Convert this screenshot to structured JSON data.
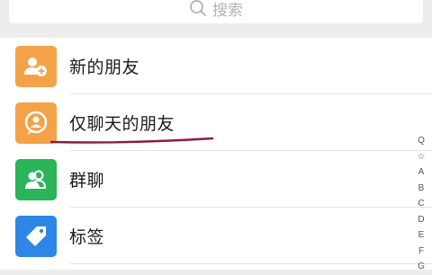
{
  "search": {
    "placeholder": "搜索"
  },
  "contacts_menu": {
    "items": [
      {
        "label": "新的朋友",
        "icon": "add-friend-icon",
        "color": "#f3a248"
      },
      {
        "label": "仅聊天的朋友",
        "icon": "chat-only-friend-icon",
        "color": "#f3a248"
      },
      {
        "label": "群聊",
        "icon": "group-chat-icon",
        "color": "#2bb45a"
      },
      {
        "label": "标签",
        "icon": "tag-icon",
        "color": "#2e86e6"
      }
    ]
  },
  "index_bar": {
    "letters": [
      "Q",
      "☆",
      "A",
      "B",
      "C",
      "D",
      "E",
      "F",
      "G"
    ]
  },
  "annotation": {
    "underline_color": "#8b1a4a"
  }
}
